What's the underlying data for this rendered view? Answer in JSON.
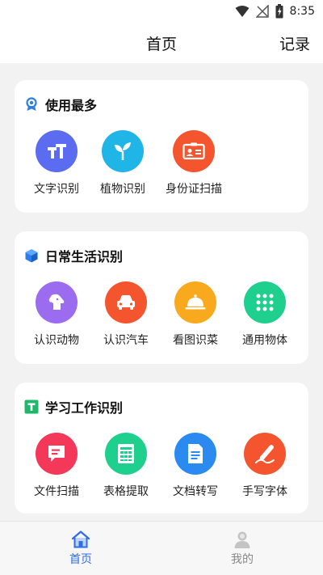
{
  "status": {
    "time": "8:35"
  },
  "header": {
    "title": "首页",
    "records_label": "记录"
  },
  "sections": [
    {
      "title": "使用最多",
      "items": [
        {
          "label": "文字识别",
          "color": "#5b6cf0",
          "icon": "text-recognize-icon"
        },
        {
          "label": "植物识别",
          "color": "#1fb5e6",
          "icon": "plant-leaf-icon"
        },
        {
          "label": "身份证扫描",
          "color": "#f4552e",
          "icon": "id-card-icon"
        }
      ]
    },
    {
      "title": "日常生活识别",
      "items": [
        {
          "label": "认识动物",
          "color": "#9b6cf0",
          "icon": "dog-icon"
        },
        {
          "label": "认识汽车",
          "color": "#f4552e",
          "icon": "car-icon"
        },
        {
          "label": "看图识菜",
          "color": "#f9a91e",
          "icon": "food-cloche-icon"
        },
        {
          "label": "通用物体",
          "color": "#1fcf8e",
          "icon": "grid-dots-icon"
        }
      ]
    },
    {
      "title": "学习工作识别",
      "items": [
        {
          "label": "文件扫描",
          "color": "#f4385a",
          "icon": "file-scan-icon"
        },
        {
          "label": "表格提取",
          "color": "#1fcf8e",
          "icon": "table-icon"
        },
        {
          "label": "文档转写",
          "color": "#2a8af0",
          "icon": "document-icon"
        },
        {
          "label": "手写字体",
          "color": "#f4552e",
          "icon": "pen-icon"
        }
      ]
    }
  ],
  "nav": {
    "home_label": "首页",
    "mine_label": "我的",
    "active_color": "#2f6ce8",
    "inactive_color": "#888888"
  }
}
